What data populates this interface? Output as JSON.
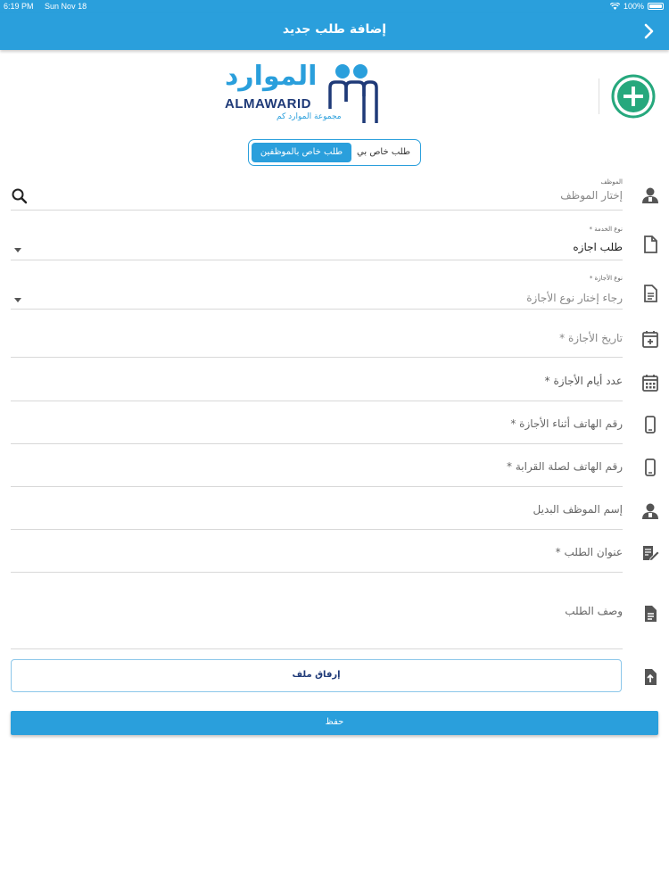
{
  "status_bar": {
    "time": "6:19 PM",
    "date": "Sun Nov 18",
    "battery": "100%"
  },
  "nav": {
    "title": "إضافة طلب جديد"
  },
  "logo": {
    "arabic": "الموارد",
    "latin": "ALMAWARID",
    "subtitle": "مجموعة الموارد كم"
  },
  "segment": {
    "personal": "طلب خاص بي",
    "employees": "طلب خاص بالموظفين",
    "selected": "employees"
  },
  "form": {
    "employee": {
      "label": "الموظف",
      "placeholder": "إختار الموظف"
    },
    "service_type": {
      "label": "نوع الخدمة *",
      "value": "طلب اجازه"
    },
    "leave_type": {
      "label": "نوع الأجازة *",
      "placeholder": "رجاء إختار نوع الأجازة"
    },
    "leave_date": {
      "placeholder": "تاريخ الأجازة *"
    },
    "leave_days": {
      "placeholder": "عدد أيام الأجازة *"
    },
    "phone_during_leave": {
      "placeholder": "رقم الهاتف أثناء الأجازة *"
    },
    "relative_phone": {
      "placeholder": "رقم الهاتف لصلة القرابة *"
    },
    "substitute_employee": {
      "placeholder": "إسم الموظف البديل"
    },
    "request_title": {
      "placeholder": "عنوان الطلب *"
    },
    "request_description": {
      "placeholder": "وصف الطلب"
    }
  },
  "buttons": {
    "attach": "إرفاق ملف",
    "save": "حفظ"
  },
  "colors": {
    "primary": "#2a9fdc",
    "add_button": "#26a87d",
    "logo_navy": "#1f3a78"
  }
}
